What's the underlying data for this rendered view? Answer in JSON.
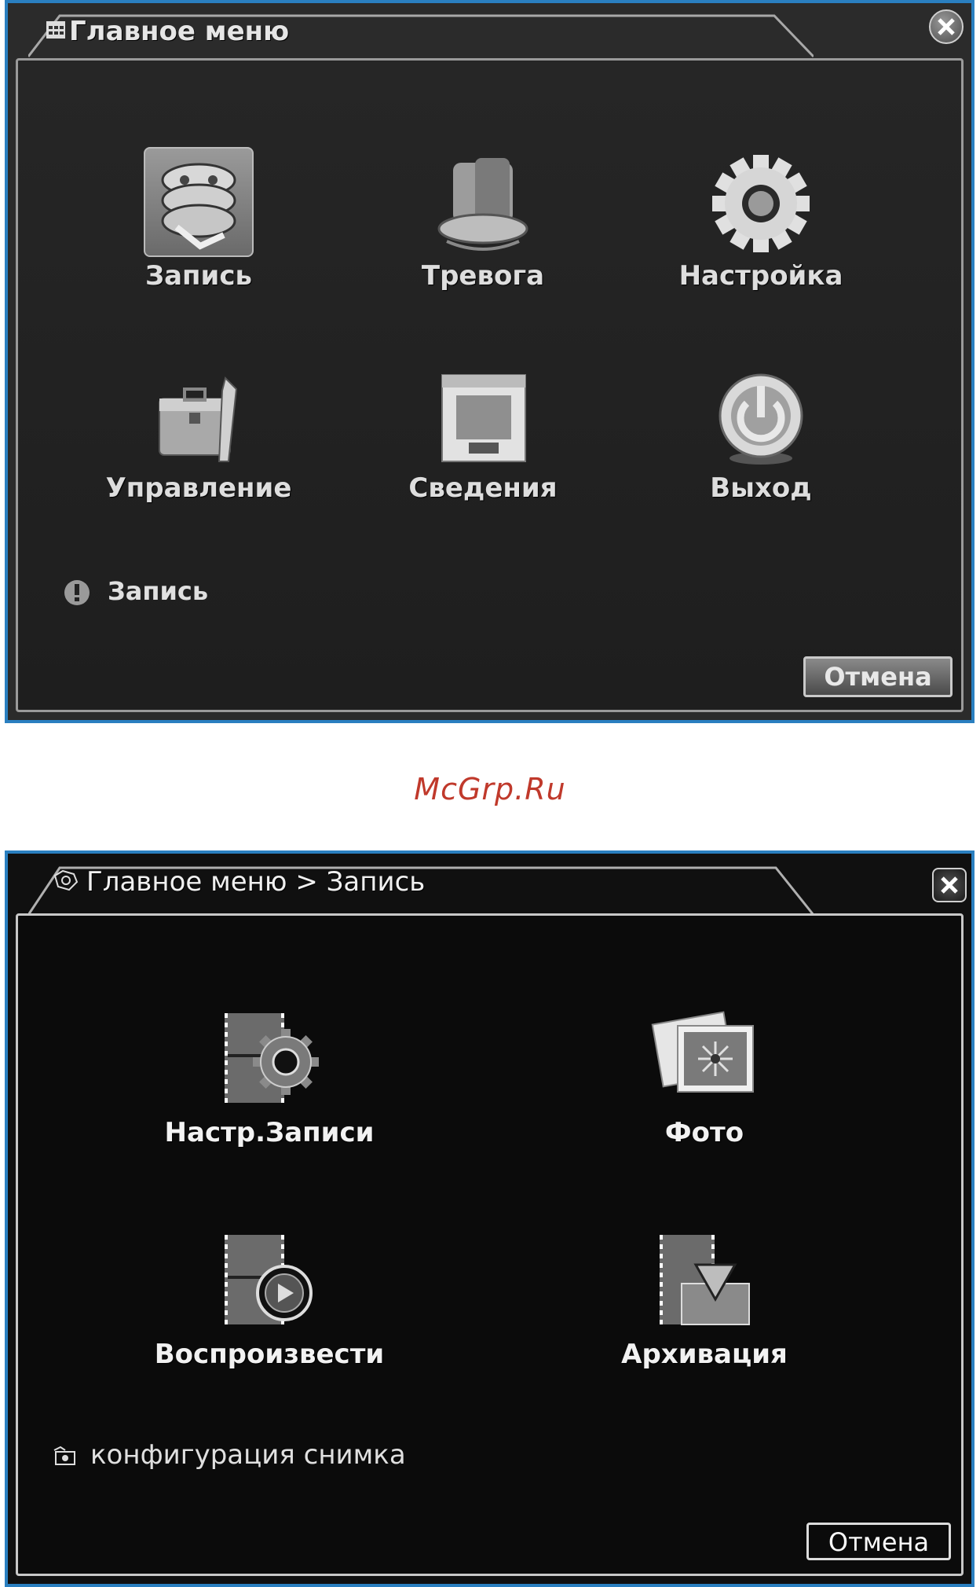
{
  "screen1": {
    "title": "Главное меню",
    "menu": [
      {
        "label": "Запись",
        "icon": "film-reel-icon"
      },
      {
        "label": "Тревога",
        "icon": "alarm-siren-icon"
      },
      {
        "label": "Настройка",
        "icon": "gear-icon"
      },
      {
        "label": "Управление",
        "icon": "toolbox-icon"
      },
      {
        "label": "Сведения",
        "icon": "info-monitor-icon"
      },
      {
        "label": "Выход",
        "icon": "power-icon"
      }
    ],
    "status_text": "Запись",
    "cancel_label": "Отмена"
  },
  "watermark": "McGrp.Ru",
  "screen2": {
    "title": "Главное меню > Запись",
    "menu": [
      {
        "label": "Настр.Записи",
        "icon": "film-gear-icon"
      },
      {
        "label": "Фото",
        "icon": "photo-icon"
      },
      {
        "label": "Воспроизвести",
        "icon": "film-play-icon"
      },
      {
        "label": "Архивация",
        "icon": "film-download-icon"
      }
    ],
    "status_text": "конфигурация снимка",
    "cancel_label": "Отмена"
  },
  "colors": {
    "frame_border": "#2a7fc0",
    "watermark": "#c0392b"
  }
}
